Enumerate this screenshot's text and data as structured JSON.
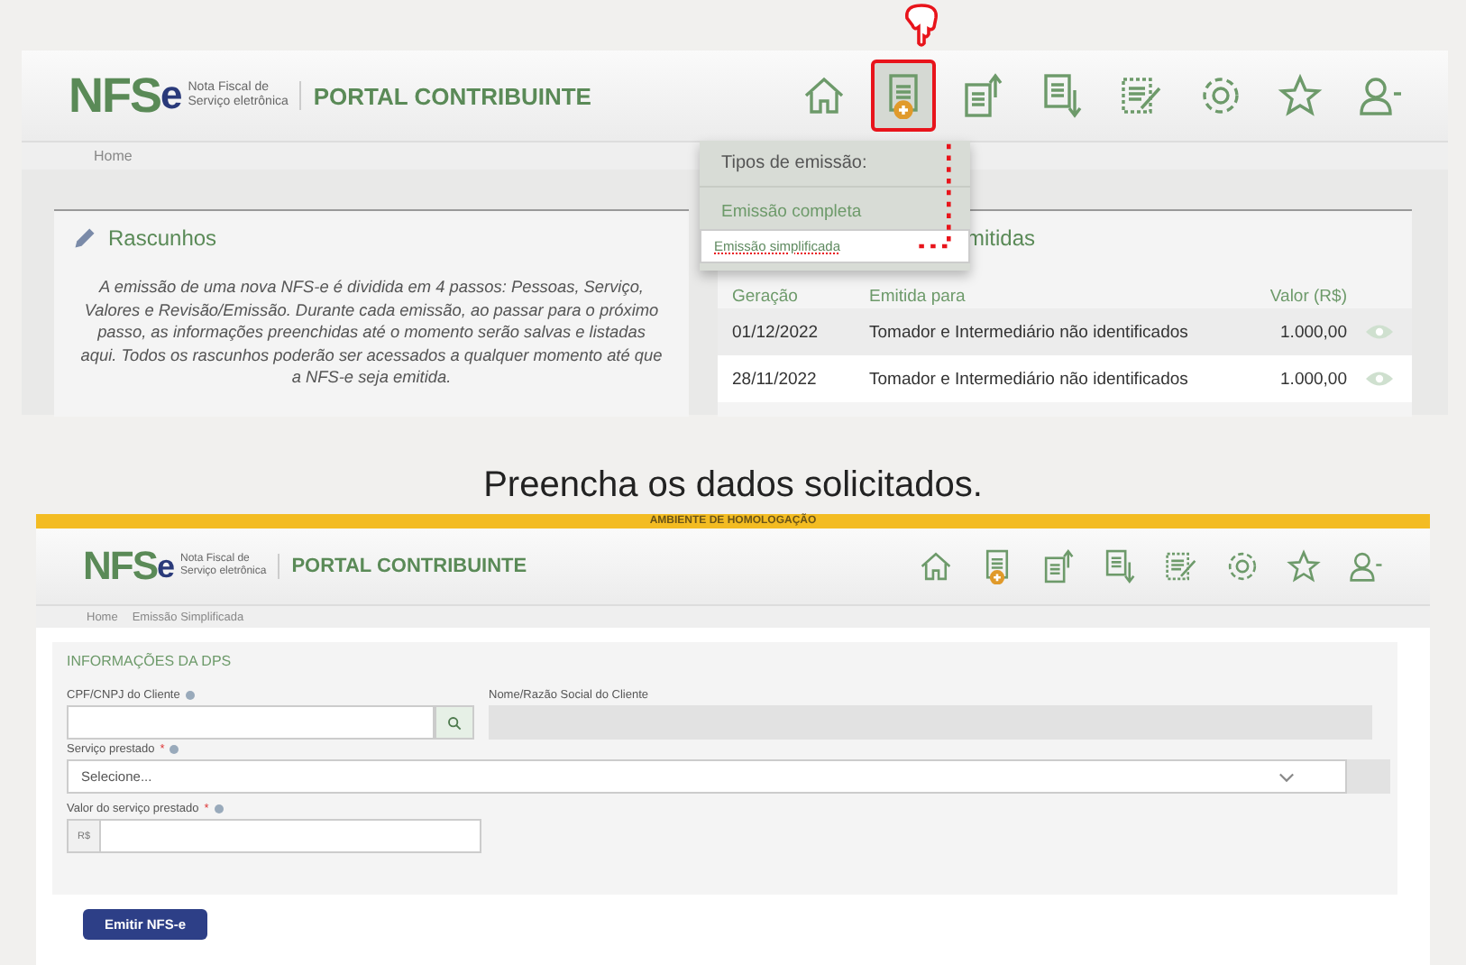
{
  "top_screenshot": {
    "logo": {
      "letters": "NFS",
      "suffix": "e",
      "tagline": [
        "Nota Fiscal de",
        "Serviço eletrônica"
      ]
    },
    "portal_title": "PORTAL CONTRIBUINTE",
    "toolbar": [
      {
        "kind": "home",
        "highlighted": false
      },
      {
        "kind": "emit",
        "highlighted": true
      },
      {
        "kind": "upload",
        "highlighted": false
      },
      {
        "kind": "download",
        "highlighted": false
      },
      {
        "kind": "edit",
        "highlighted": false
      },
      {
        "kind": "gear",
        "highlighted": false
      },
      {
        "kind": "star",
        "highlighted": false
      },
      {
        "kind": "user",
        "highlighted": false
      }
    ],
    "breadcrumb": [
      "Home"
    ],
    "menu": {
      "title": "Tipos de emissão:",
      "items": [
        {
          "label": "Emissão completa",
          "selected": false
        },
        {
          "label": "Emissão simplificada",
          "selected": true
        }
      ]
    },
    "drafts": {
      "title": "Rascunhos",
      "text": "A emissão de uma nova NFS-e é dividida em 4 passos: Pessoas, Serviço, Valores e Revisão/Emissão. Durante cada emissão, ao passar para o próximo passo, as informações preenchidas até o momento serão salvas e listadas aqui. Todos os rascunhos poderão ser acessados a qualquer momento até que a NFS-e seja emitida."
    },
    "issued": {
      "title": "mitidas",
      "columns": [
        "Geração",
        "Emitida para",
        "Valor (R$)"
      ],
      "rows": [
        {
          "date": "01/12/2022",
          "recipient": "Tomador e Intermediário não identificados",
          "value": "1.000,00"
        },
        {
          "date": "28/11/2022",
          "recipient": "Tomador e Intermediário não identificados",
          "value": "1.000,00"
        }
      ]
    }
  },
  "caption": "Preencha os dados solicitados.",
  "bottom_screenshot": {
    "environment_banner": "AMBIENTE DE HOMOLOGAÇÃO",
    "logo": {
      "letters": "NFS",
      "suffix": "e",
      "tagline": [
        "Nota Fiscal de",
        "Serviço eletrônica"
      ]
    },
    "portal_title": "PORTAL CONTRIBUINTE",
    "toolbar": [
      {
        "kind": "home"
      },
      {
        "kind": "emit"
      },
      {
        "kind": "upload"
      },
      {
        "kind": "download"
      },
      {
        "kind": "edit"
      },
      {
        "kind": "gear"
      },
      {
        "kind": "star"
      },
      {
        "kind": "user"
      }
    ],
    "breadcrumb": [
      "Home",
      "Emissão Simplificada"
    ],
    "form": {
      "title": "INFORMAÇÕES DA DPS",
      "client_id": {
        "label": "CPF/CNPJ do Cliente"
      },
      "client_name": {
        "label": "Nome/Razão Social do Cliente"
      },
      "service": {
        "label": "Serviço prestado",
        "required": "*",
        "value": "Selecione..."
      },
      "amount": {
        "label": "Valor do serviço prestado",
        "required": "*",
        "prefix": "R$"
      }
    },
    "submit_button": "Emitir NFS-e"
  }
}
